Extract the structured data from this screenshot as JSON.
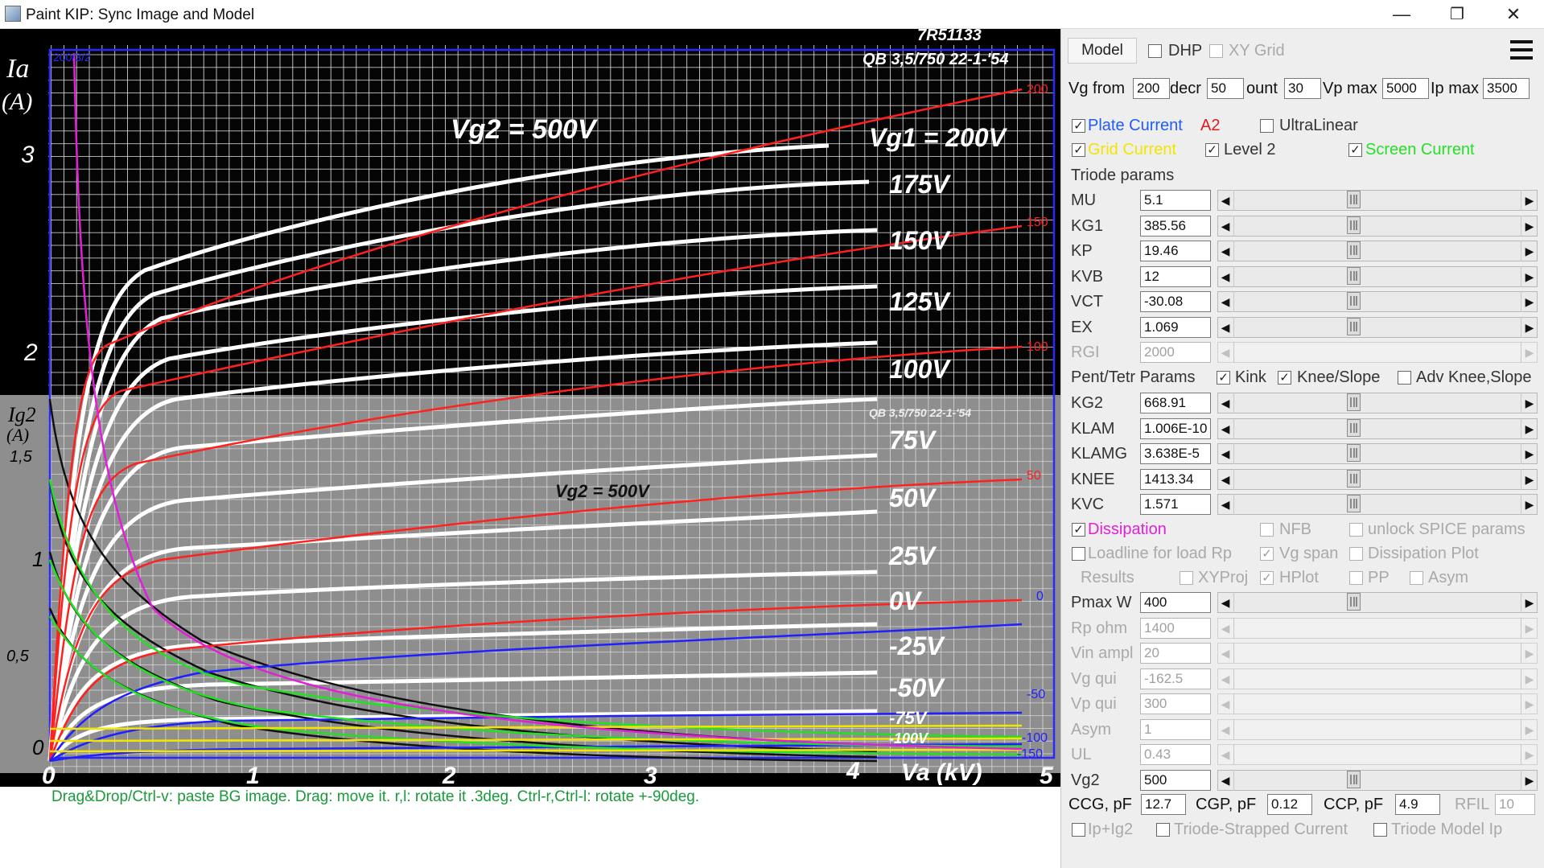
{
  "window": {
    "title": "Paint KIP: Sync Image and Model",
    "minimize": "—",
    "restore": "❐",
    "close": "✕"
  },
  "status_hint": "Drag&Drop/Ctrl-v: paste BG image. Drag: move it. r,l: rotate it .3deg. Ctrl-r,Ctrl-l: rotate +-90deg.",
  "plot": {
    "serial": "7R51133",
    "tube_type": "QB 3,5/750   22-1-'54",
    "tube_type_small": "QB 3,5/750   22-1-'54",
    "ia_label": "Ia",
    "ia_unit": "(A)",
    "ig2_label": "Ig2",
    "ig2_unit": "(A)",
    "vg2_label": "Vg2 = 500V",
    "vg2_label_small": "Vg2 = 500V",
    "vg1_label": "Vg1 = 200V",
    "va_label": "Va (kV)",
    "y_ticks": [
      "3",
      "2"
    ],
    "lower_y_ticks": [
      "1,5",
      "1",
      "0,5",
      "0"
    ],
    "x_ticks": [
      "0",
      "1",
      "2",
      "3",
      "4",
      "5"
    ],
    "curve_labels": [
      "175V",
      "150V",
      "125V",
      "100V",
      "75V",
      "50V",
      "25V",
      "0V",
      "-25V",
      "-50V",
      "-75V",
      "-100V"
    ],
    "overlay_labels": [
      "200",
      "150",
      "100",
      "50",
      "0",
      "-50",
      "-100",
      "-150"
    ],
    "corner_label": "200/3/2"
  },
  "panel": {
    "model_button": "Model",
    "dhp": {
      "label": "DHP",
      "checked": false
    },
    "xy_grid": {
      "label": "XY Grid",
      "checked": false
    },
    "vg_from": {
      "label": "Vg from",
      "value": "200"
    },
    "decr": {
      "label": "decr",
      "value": "50"
    },
    "count": {
      "label": "ount",
      "value": "30"
    },
    "vp_max": {
      "label": "Vp max",
      "value": "5000"
    },
    "ip_max": {
      "label": "Ip max",
      "value": "3500"
    },
    "plate_current": {
      "label": "Plate Current",
      "checked": true,
      "color": "#1e5cff"
    },
    "a2": {
      "label": "A2",
      "color": "#e11b1b"
    },
    "ultralinear": {
      "label": "UltraLinear",
      "checked": false
    },
    "grid_current": {
      "label": "Grid Current",
      "checked": true,
      "color": "#f2e600"
    },
    "level2": {
      "label": "Level 2",
      "checked": true
    },
    "screen_current": {
      "label": "Screen Current",
      "checked": true,
      "color": "#25e025"
    },
    "triode_params_label": "Triode params",
    "triode_params": [
      {
        "name": "MU",
        "value": "5.1",
        "enabled": true
      },
      {
        "name": "KG1",
        "value": "385.56",
        "enabled": true
      },
      {
        "name": "KP",
        "value": "19.46",
        "enabled": true
      },
      {
        "name": "KVB",
        "value": "12",
        "enabled": true
      },
      {
        "name": "VCT",
        "value": "-30.08",
        "enabled": true
      },
      {
        "name": "EX",
        "value": "1.069",
        "enabled": true
      },
      {
        "name": "RGI",
        "value": "2000",
        "enabled": false
      }
    ],
    "pent_label": "Pent/Tetr Params",
    "kink": {
      "label": "Kink",
      "checked": true
    },
    "knee_slope": {
      "label": "Knee/Slope",
      "checked": true
    },
    "adv_knee": {
      "label": "Adv Knee,Slope",
      "checked": false
    },
    "pent_params": [
      {
        "name": "KG2",
        "value": "668.91",
        "enabled": true
      },
      {
        "name": "KLAM",
        "value": "1.006E-10",
        "enabled": true
      },
      {
        "name": "KLAMG",
        "value": "3.638E-5",
        "enabled": true
      },
      {
        "name": "KNEE",
        "value": "1413.34",
        "enabled": true
      },
      {
        "name": "KVC",
        "value": "1.571",
        "enabled": true
      }
    ],
    "dissipation": {
      "label": "Dissipation",
      "checked": true,
      "color": "#e21fd8"
    },
    "nfb": {
      "label": "NFB",
      "checked": false
    },
    "unlock_spice": {
      "label": "unlock SPICE params",
      "checked": false
    },
    "loadline": {
      "label": "Loadline for load Rp",
      "checked": false
    },
    "vg_span": {
      "label": "Vg span",
      "checked": true
    },
    "dissipation_plot": {
      "label": "Dissipation Plot",
      "checked": false
    },
    "results_label": "Results",
    "xyproj": {
      "label": "XYProj",
      "checked": false
    },
    "hplot": {
      "label": "HPlot",
      "checked": true
    },
    "pp": {
      "label": "PP",
      "checked": false
    },
    "asym_cb": {
      "label": "Asym",
      "checked": false
    },
    "load_params": [
      {
        "name": "Pmax W",
        "value": "400",
        "enabled": true
      },
      {
        "name": "Rp ohm",
        "value": "1400",
        "enabled": false
      },
      {
        "name": "Vin ampl",
        "value": "20",
        "enabled": false
      },
      {
        "name": "Vg qui",
        "value": "-162.5",
        "enabled": false
      },
      {
        "name": "Vp qui",
        "value": "300",
        "enabled": false
      },
      {
        "name": "Asym",
        "value": "1",
        "enabled": false
      },
      {
        "name": "UL",
        "value": "0.43",
        "enabled": false
      },
      {
        "name": "Vg2",
        "value": "500",
        "enabled": true
      }
    ],
    "ccg": {
      "label": "CCG, pF",
      "value": "12.7"
    },
    "cgp": {
      "label": "CGP, pF",
      "value": "0.12"
    },
    "ccp": {
      "label": "CCP, pF",
      "value": "4.9"
    },
    "rfil": {
      "label": "RFIL",
      "value": "10"
    },
    "ip_ig2": {
      "label": "Ip+Ig2",
      "checked": false
    },
    "triode_strapped": {
      "label": "Triode-Strapped Current",
      "checked": false
    },
    "triode_model_ip": {
      "label": "Triode Model Ip",
      "checked": false
    }
  }
}
